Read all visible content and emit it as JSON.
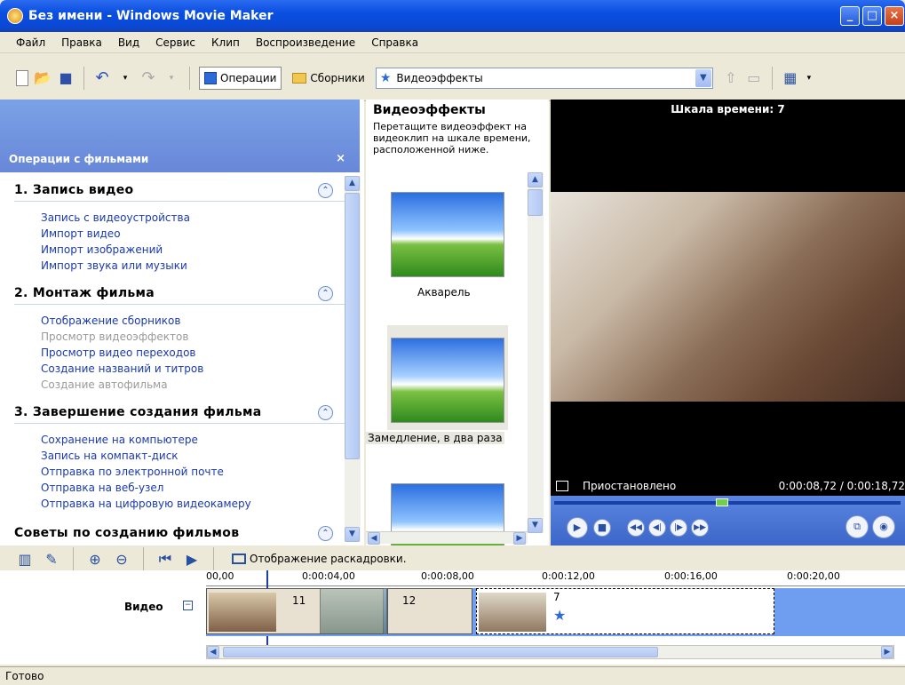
{
  "window": {
    "title": "Без имени - Windows Movie Maker"
  },
  "menu": [
    "Файл",
    "Правка",
    "Вид",
    "Сервис",
    "Клип",
    "Воспроизведение",
    "Справка"
  ],
  "toolbar": {
    "operations_label": "Операции",
    "collections_label": "Сборники",
    "combo_value": "Видеоэффекты"
  },
  "taskpane": {
    "title": "Операции с фильмами",
    "close": "×",
    "sections": [
      {
        "title": "1. Запись видео",
        "links": [
          "Запись с видеоустройства",
          "Импорт видео",
          "Импорт изображений",
          "Импорт звука или музыки"
        ]
      },
      {
        "title": "2. Монтаж фильма",
        "links": [
          "Отображение сборников",
          "Просмотр видеоэффектов",
          "Просмотр видео переходов",
          "Создание названий и титров",
          "Создание автофильма"
        ]
      },
      {
        "title": "3. Завершение создания фильма",
        "links": [
          "Сохранение на компьютере",
          "Запись на компакт-диск",
          "Отправка по электронной почте",
          "Отправка на веб-узел",
          "Отправка на цифровую видеокамеру"
        ]
      },
      {
        "title": "Советы по созданию фильмов",
        "links": []
      }
    ]
  },
  "effects": {
    "title": "Видеоэффекты",
    "description": "Перетащите видеоэффект на видеоклип на шкале времени, расположенной ниже.",
    "items": [
      "Акварель",
      "Замедление, в два раза"
    ]
  },
  "monitor": {
    "title": "Шкала времени: 7",
    "status": "Приостановлено",
    "time": "0:00:08,72 / 0:00:18,72"
  },
  "timeline": {
    "storyboard_label": "Отображение раскадровки.",
    "ruler": [
      "00,00",
      "0:00:04,00",
      "0:00:08,00",
      "0:00:12,00",
      "0:00:16,00",
      "0:00:20,00"
    ],
    "track_label": "Видео",
    "clips": [
      "11",
      "12",
      "7"
    ]
  },
  "statusbar": {
    "text": "Готово"
  },
  "colors": {
    "title_blue": "#0a4fe0",
    "taskpane_header": "#7ba2e7",
    "link": "#1b3aad",
    "disabled": "#9a9a9a"
  }
}
